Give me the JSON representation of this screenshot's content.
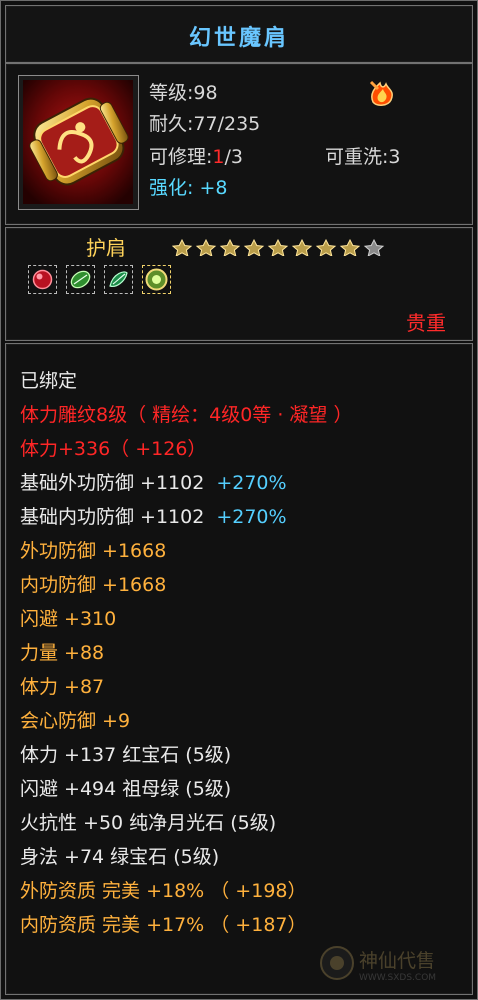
{
  "title": "幻世魔肩",
  "header": {
    "level_label": "等级",
    "level_value": "98",
    "durability_label": "耐久",
    "durability_value": "77/235",
    "repair_label": "可修理",
    "repair_current": "1",
    "repair_total": "/3",
    "rewash_label": "可重洗",
    "rewash_value": "3",
    "enhance_label": "强化",
    "enhance_value": "+8",
    "item_icon": "scroll-shoulder-icon",
    "badge_icon": "flame-badge-icon"
  },
  "slot": {
    "label": "护肩",
    "stars": {
      "filled": 8,
      "total": 9
    },
    "gems": [
      {
        "icon": "red-gem-icon"
      },
      {
        "icon": "green-gem-icon"
      },
      {
        "icon": "green-jade-icon"
      },
      {
        "icon": "gold-gem-icon"
      }
    ],
    "rarity": "贵重"
  },
  "attributes": [
    {
      "text": "已绑定",
      "color": "white",
      "suffix": ""
    },
    {
      "text": "体力雕纹8级（ 精绘：4级0等 · 凝望 ）",
      "color": "red2",
      "suffix": ""
    },
    {
      "text": "体力+336（ +126）",
      "color": "red2",
      "suffix": ""
    },
    {
      "text": "基础外功防御 +1102",
      "color": "white",
      "suffix": "+270%"
    },
    {
      "text": "基础内功防御 +1102",
      "color": "white",
      "suffix": "+270%"
    },
    {
      "text": "外功防御 +1668",
      "color": "orange",
      "suffix": ""
    },
    {
      "text": "内功防御 +1668",
      "color": "orange",
      "suffix": ""
    },
    {
      "text": "闪避 +310",
      "color": "orange",
      "suffix": ""
    },
    {
      "text": "力量 +88",
      "color": "orange",
      "suffix": ""
    },
    {
      "text": "体力 +87",
      "color": "orange",
      "suffix": ""
    },
    {
      "text": "会心防御 +9",
      "color": "orange",
      "suffix": ""
    },
    {
      "text": "体力 +137 红宝石 (5级)",
      "color": "white",
      "suffix": ""
    },
    {
      "text": "闪避 +494 祖母绿 (5级)",
      "color": "white",
      "suffix": ""
    },
    {
      "text": "火抗性 +50 纯净月光石 (5级)",
      "color": "white",
      "suffix": ""
    },
    {
      "text": "身法 +74 绿宝石 (5级)",
      "color": "white",
      "suffix": ""
    },
    {
      "text": "外防资质   完美 +18% （ +198）",
      "color": "orange",
      "suffix": ""
    },
    {
      "text": "内防资质   完美 +17% （ +187）",
      "color": "orange",
      "suffix": ""
    }
  ],
  "watermark": {
    "logo_text": "神仙代售",
    "url": "WWW.SXDS.COM"
  }
}
